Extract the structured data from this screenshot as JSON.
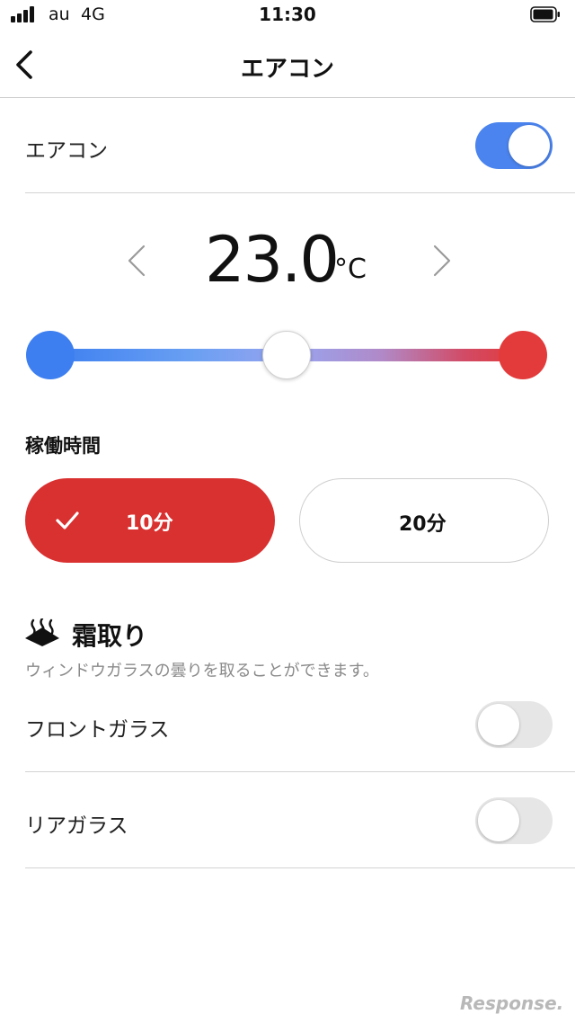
{
  "status_bar": {
    "carrier": "au",
    "network": "4G",
    "time": "11:30"
  },
  "nav": {
    "title": "エアコン",
    "back_icon": "chevron-left-icon"
  },
  "aircon": {
    "label": "エアコン",
    "enabled": true,
    "toggle_on_color": "#4b84ee"
  },
  "temperature": {
    "value": "23.0",
    "unit": "°C",
    "slider_fraction": 0.5,
    "cold_color": "#3d7ff0",
    "hot_color": "#e33b3b"
  },
  "duration": {
    "label": "稼働時間",
    "options": [
      {
        "label": "10分",
        "selected": true
      },
      {
        "label": "20分",
        "selected": false
      }
    ],
    "selected_color": "#d93030"
  },
  "defrost": {
    "title": "霜取り",
    "icon": "defrost-heat-icon",
    "description": "ウィンドウガラスの曇りを取ることができます。",
    "items": [
      {
        "label": "フロントガラス",
        "enabled": false
      },
      {
        "label": "リアガラス",
        "enabled": false
      }
    ],
    "toggle_off_color": "#e6e6e6"
  },
  "watermark": "Response."
}
